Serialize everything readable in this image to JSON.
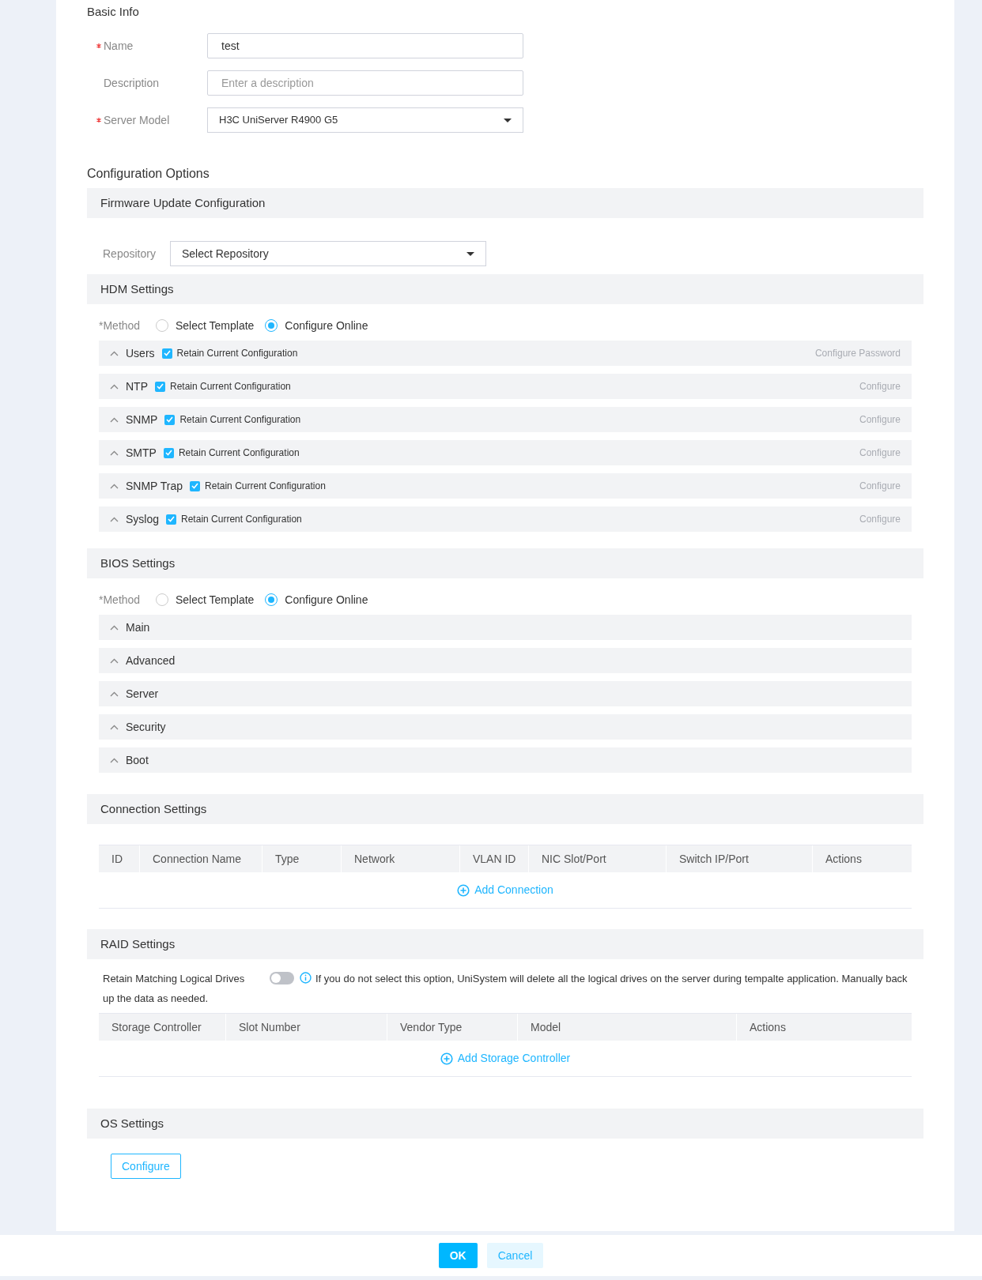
{
  "basic_info": {
    "title": "Basic Info",
    "fields": [
      {
        "label": "Name",
        "required": true,
        "kind": "text",
        "value": "test"
      },
      {
        "label": "Description",
        "required": false,
        "kind": "text",
        "placeholder": "Enter a description"
      },
      {
        "label": "Server Model",
        "required": true,
        "kind": "select",
        "value": "H3C UniServer R4900 G5"
      }
    ]
  },
  "configuration_options": {
    "title": "Configuration Options"
  },
  "firmware_update": {
    "title": "Firmware Update Configuration",
    "repository": {
      "label": "Repository",
      "value": "Select Repository"
    }
  },
  "hdm_settings": {
    "title": "HDM Settings",
    "method": {
      "label": "*Method",
      "options": [
        {
          "label": "Select Template",
          "selected": false
        },
        {
          "label": "Configure Online",
          "selected": true
        }
      ]
    },
    "items": [
      {
        "label": "Users",
        "checkbox": {
          "label": "Retain Current Configuration",
          "checked": true
        },
        "action": {
          "label": "Configure Password",
          "disabled": true
        }
      },
      {
        "label": "NTP",
        "checkbox": {
          "label": "Retain Current Configuration",
          "checked": true
        },
        "action": {
          "label": "Configure",
          "disabled": true
        }
      },
      {
        "label": "SNMP",
        "checkbox": {
          "label": "Retain Current Configuration",
          "checked": true
        },
        "action": {
          "label": "Configure",
          "disabled": true
        }
      },
      {
        "label": "SMTP",
        "checkbox": {
          "label": "Retain Current Configuration",
          "checked": true
        },
        "action": {
          "label": "Configure",
          "disabled": true
        }
      },
      {
        "label": "SNMP Trap",
        "checkbox": {
          "label": "Retain Current Configuration",
          "checked": true
        },
        "action": {
          "label": "Configure",
          "disabled": true
        }
      },
      {
        "label": "Syslog",
        "checkbox": {
          "label": "Retain Current Configuration",
          "checked": true
        },
        "action": {
          "label": "Configure",
          "disabled": true
        }
      }
    ]
  },
  "bios_settings": {
    "title": "BIOS Settings",
    "method": {
      "label": "*Method",
      "options": [
        {
          "label": "Select Template",
          "selected": false
        },
        {
          "label": "Configure Online",
          "selected": true
        }
      ]
    },
    "items": [
      {
        "label": "Main"
      },
      {
        "label": "Advanced"
      },
      {
        "label": "Server"
      },
      {
        "label": "Security"
      },
      {
        "label": "Boot"
      }
    ]
  },
  "connection_settings": {
    "title": "Connection Settings",
    "table": {
      "columns": [
        "ID",
        "Connection Name",
        "Type",
        "Network",
        "VLAN ID",
        "NIC Slot/Port",
        "Switch IP/Port",
        "Actions"
      ]
    },
    "add_link": "Add Connection"
  },
  "raid_settings": {
    "title": "RAID Settings",
    "retain": {
      "label": "Retain Matching Logical Drives",
      "on": false,
      "info": "If you do not select this option, UniSystem will delete all the logical drives on the server during tempalte application. Manually back up the data as needed."
    },
    "table": {
      "columns": [
        "Storage Controller",
        "Slot Number",
        "Vendor Type",
        "Model",
        "Actions"
      ]
    },
    "add_link": "Add Storage Controller"
  },
  "os_settings": {
    "title": "OS Settings",
    "button": "Configure"
  },
  "footer": {
    "buttons": [
      {
        "label": "OK",
        "kind": "primary"
      },
      {
        "label": "Cancel",
        "kind": "secondary"
      }
    ]
  }
}
